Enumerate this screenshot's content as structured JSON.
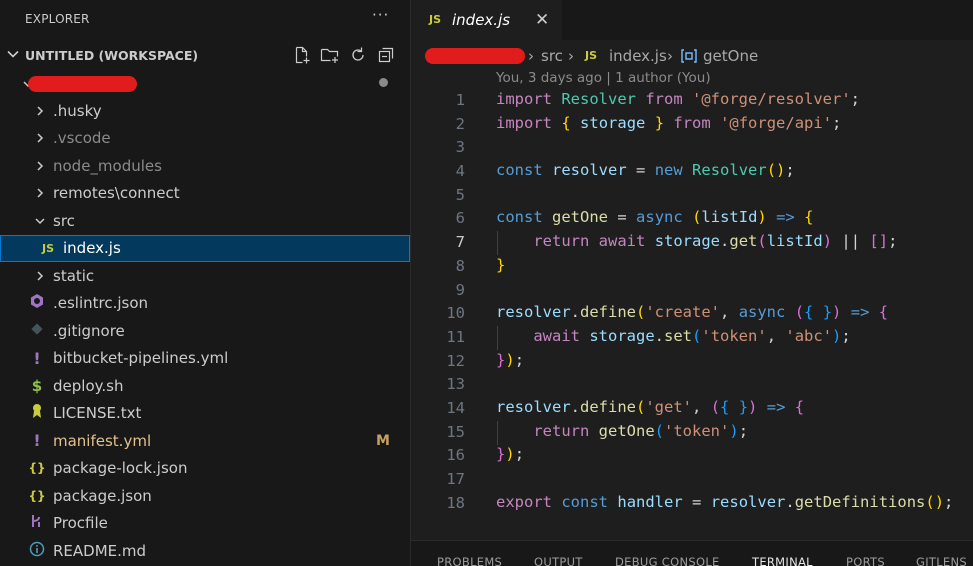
{
  "explorer": {
    "title": "EXPLORER",
    "more": "···",
    "workspace_label": "UNTITLED (WORKSPACE)",
    "items": [
      {
        "label": ".husky",
        "kind": "folder"
      },
      {
        "label": ".vscode",
        "kind": "folder",
        "dim": true
      },
      {
        "label": "node_modules",
        "kind": "folder",
        "dim": true
      },
      {
        "label": "remotes\\connect",
        "kind": "folder"
      },
      {
        "label": "src",
        "kind": "folder-open"
      },
      {
        "label": "index.js",
        "kind": "js",
        "selected": true
      },
      {
        "label": "static",
        "kind": "folder"
      },
      {
        "label": ".eslintrc.json",
        "kind": "eslint"
      },
      {
        "label": ".gitignore",
        "kind": "git"
      },
      {
        "label": "bitbucket-pipelines.yml",
        "kind": "yml"
      },
      {
        "label": "deploy.sh",
        "kind": "sh"
      },
      {
        "label": "LICENSE.txt",
        "kind": "license"
      },
      {
        "label": "manifest.yml",
        "kind": "yml",
        "modified": true,
        "badge": "M"
      },
      {
        "label": "package-lock.json",
        "kind": "json"
      },
      {
        "label": "package.json",
        "kind": "json"
      },
      {
        "label": "Procfile",
        "kind": "procfile"
      },
      {
        "label": "README.md",
        "kind": "info"
      }
    ]
  },
  "editor": {
    "tab": {
      "icon": "JS",
      "name": "index.js",
      "close": "✕"
    },
    "breadcrumb": {
      "src": "src",
      "file_icon": "JS",
      "file": "index.js",
      "symbol": "getOne"
    },
    "blame": "You, 3 days ago | 1 author (You)",
    "active_line": 7,
    "lines": [
      "1",
      "2",
      "3",
      "4",
      "5",
      "6",
      "7",
      "8",
      "9",
      "10",
      "11",
      "12",
      "13",
      "14",
      "15",
      "16",
      "17",
      "18"
    ]
  },
  "panel": {
    "tabs": [
      "PROBLEMS",
      "OUTPUT",
      "DEBUG CONSOLE",
      "TERMINAL",
      "PORTS",
      "GITLENS"
    ],
    "active": "TERMINAL"
  },
  "colors": {
    "accent": "#0078d4",
    "selection": "#04395e",
    "redaction": "#e11c1c",
    "modified": "#e2c08d"
  }
}
